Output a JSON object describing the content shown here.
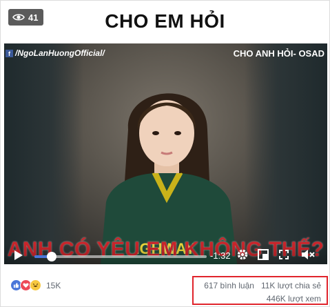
{
  "header": {
    "view_count": "41",
    "title": "CHO EM HỎI"
  },
  "video": {
    "page_tag": "/NgoLanHuongOfficial/",
    "video_title": "CHO ANH HỎI- OSAD",
    "caption": "ANH CÓ YÊU EM KHÔNG THẾ?",
    "shirt_text": "IGHWAY",
    "time_remaining": "-1:32",
    "progress": 0.1
  },
  "footer": {
    "reaction_count": "15K",
    "comments": "617 bình luận",
    "shares": "11K lượt chia sẻ",
    "views": "446K lượt xem"
  },
  "colors": {
    "accent_blue": "#4a76d9",
    "caption_red": "#c9252b",
    "highlight_red": "#e0232b"
  }
}
